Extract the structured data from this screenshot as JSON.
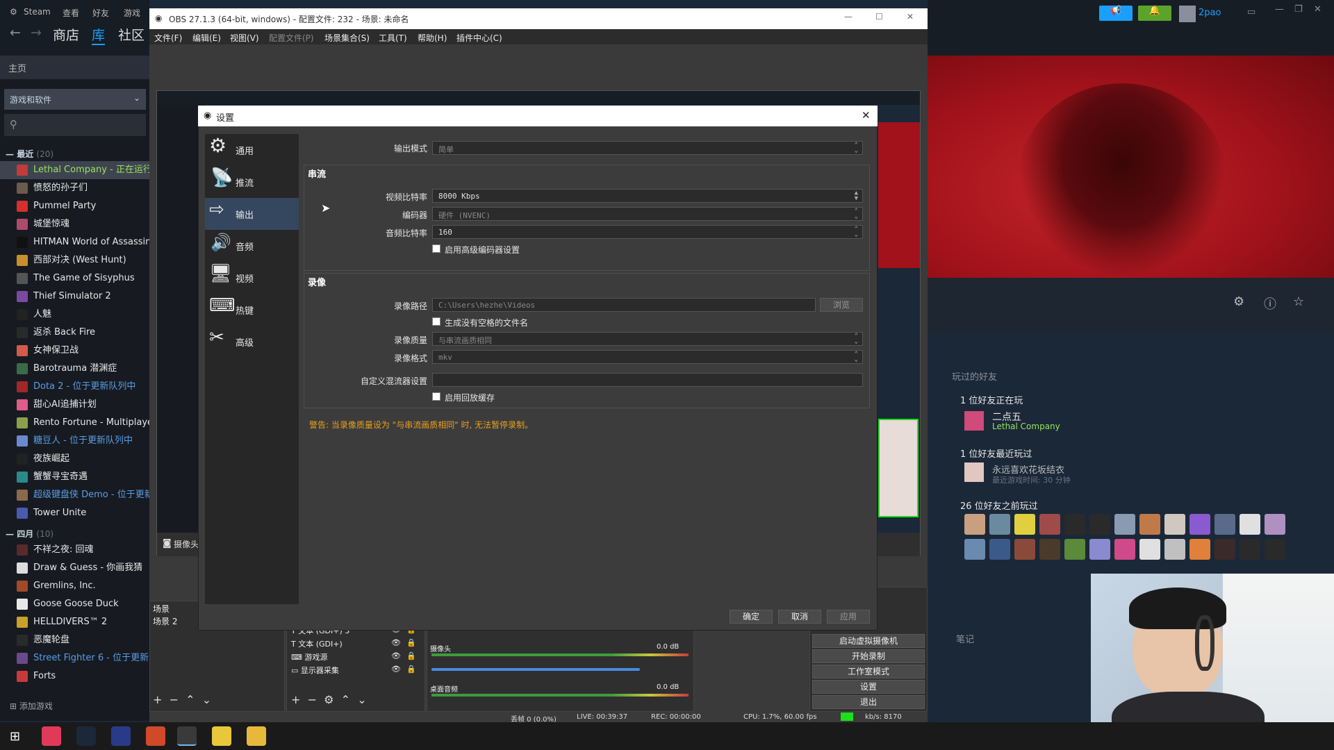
{
  "steam": {
    "menu": [
      "Steam",
      "查看",
      "好友",
      "游戏"
    ],
    "nav": [
      "商店",
      "库",
      "社区"
    ],
    "home": "主页",
    "filter": "游戏和软件",
    "group_recent": "最近",
    "group_recent_count": "(20)",
    "group_april": "四月",
    "group_april_count": "(10)",
    "recent_games": [
      {
        "name": "Lethal Company",
        "status": " - 正在运行",
        "color": "#c23b3b"
      },
      {
        "name": "愤怒的孙子们",
        "status": "",
        "color": "#6d5a4a"
      },
      {
        "name": "Pummel Party",
        "status": "",
        "color": "#d4302c"
      },
      {
        "name": "城堡惊魂",
        "status": "",
        "color": "#b04a6a"
      },
      {
        "name": "HITMAN World of Assassination",
        "status": "",
        "color": "#111111"
      },
      {
        "name": "西部对决 (West Hunt)",
        "status": "",
        "color": "#c8902c"
      },
      {
        "name": "The Game of Sisyphus",
        "status": "",
        "color": "#555555"
      },
      {
        "name": "Thief Simulator 2",
        "status": "",
        "color": "#7a4aa0"
      },
      {
        "name": "人魅",
        "status": "",
        "color": "#222222"
      },
      {
        "name": "返杀 Back Fire",
        "status": "",
        "color": "#2a2a2a"
      },
      {
        "name": "女神保卫战",
        "status": "",
        "color": "#d45a4a"
      },
      {
        "name": "Barotrauma 潜渊症",
        "status": "",
        "color": "#3a6a4a"
      },
      {
        "name": "Dota 2",
        "status": " - 位于更新队列中",
        "color": "#a02828"
      },
      {
        "name": "甜心AI追捕计划",
        "status": "",
        "color": "#e05a8a"
      },
      {
        "name": "Rento Fortune - Multiplayer",
        "status": "",
        "color": "#8aa04a"
      },
      {
        "name": "糖豆人",
        "status": " - 位于更新队列中",
        "color": "#6a8ad0"
      },
      {
        "name": "夜族崛起",
        "status": "",
        "color": "#222222"
      },
      {
        "name": "蟹蟹寻宝奇遇",
        "status": "",
        "color": "#2a8a8a"
      },
      {
        "name": "超级键盘侠 Demo",
        "status": " - 位于更新队列中",
        "color": "#8a6a4a"
      },
      {
        "name": "Tower Unite",
        "status": "",
        "color": "#4a5ab0"
      }
    ],
    "april_games": [
      {
        "name": "不祥之夜: 回魂",
        "status": "",
        "color": "#5a2a2a"
      },
      {
        "name": "Draw & Guess - 你画我猜",
        "status": "",
        "color": "#dddddd"
      },
      {
        "name": "Gremlins, Inc.",
        "status": "",
        "color": "#a04a2a"
      },
      {
        "name": "Goose Goose Duck",
        "status": "",
        "color": "#e8e8e8"
      },
      {
        "name": "HELLDIVERS™ 2",
        "status": "",
        "color": "#c8a02a"
      },
      {
        "name": "恶魔轮盘",
        "status": "",
        "color": "#2a2a2a"
      },
      {
        "name": "Street Fighter 6",
        "status": " - 位于更新队列中",
        "color": "#6a4a8a"
      },
      {
        "name": "Forts",
        "status": "",
        "color": "#c83a3a"
      }
    ],
    "add_game": "添加游戏",
    "user_name": "2pao",
    "friends_header": "玩过的好友",
    "friends_playing_title": "1 位好友正在玩",
    "friend_playing_name": "二点五",
    "friend_playing_game": "Lethal Company",
    "friends_recent_title": "1 位好友最近玩过",
    "friend_recent_name": "永远喜欢花坂结衣",
    "friend_recent_time": "最近游戏时间: 30 分钟",
    "friends_before_title": "26 位好友之前玩过",
    "notes": "笔记"
  },
  "obs": {
    "window_title": "OBS 27.1.3 (64-bit, windows) - 配置文件: 232 - 场景: 未命名",
    "menu": [
      "文件(F)",
      "编辑(E)",
      "视图(V)",
      "配置文件(P)",
      "场景集合(S)",
      "工具(T)",
      "帮助(H)",
      "插件中心(C)"
    ],
    "source_toolbar_label": "摄像头",
    "scenes_header": "场景",
    "scenes": [
      "场景 2"
    ],
    "sources": [
      "文本 (GDI+) 3",
      "文本 (GDI+)",
      "游戏源",
      "显示器采集"
    ],
    "mixer": [
      {
        "name": "摄像头",
        "db": "0.0 dB"
      },
      {
        "name": "桌面音频",
        "db": "0.0 dB"
      }
    ],
    "controls": [
      "启动虚拟摄像机",
      "开始录制",
      "工作室模式",
      "设置",
      "退出"
    ],
    "status": {
      "dropped": "丢帧 0 (0.0%)",
      "live": "LIVE: 00:39:37",
      "rec": "REC: 00:00:00",
      "cpu": "CPU: 1.7%, 60.00 fps",
      "kbps": "kb/s: 8170"
    }
  },
  "settings": {
    "title": "设置",
    "sidebar": [
      "通用",
      "推流",
      "输出",
      "音频",
      "视频",
      "热键",
      "高级"
    ],
    "output_mode_label": "输出模式",
    "output_mode_value": "简单",
    "streaming_header": "串流",
    "video_bitrate_label": "视频比特率",
    "video_bitrate_value": "8000 Kbps",
    "encoder_label": "编码器",
    "encoder_value": "硬件 (NVENC)",
    "audio_bitrate_label": "音频比特率",
    "audio_bitrate_value": "160",
    "advanced_encoder_label": "启用高级编码器设置",
    "recording_header": "录像",
    "rec_path_label": "录像路径",
    "rec_path_value": "C:\\Users\\hezhe\\Videos",
    "browse_label": "浏览",
    "no_space_label": "生成没有空格的文件名",
    "rec_quality_label": "录像质量",
    "rec_quality_value": "与串流画质相同",
    "rec_format_label": "录像格式",
    "rec_format_value": "mkv",
    "muxer_label": "自定义混流器设置",
    "muxer_value": "",
    "replay_label": "启用回放缓存",
    "warning": "警告: 当录像质量设为 \"与串流画质相同\" 时, 无法暂停录制。",
    "ok": "确定",
    "cancel": "取消",
    "apply": "应用"
  }
}
